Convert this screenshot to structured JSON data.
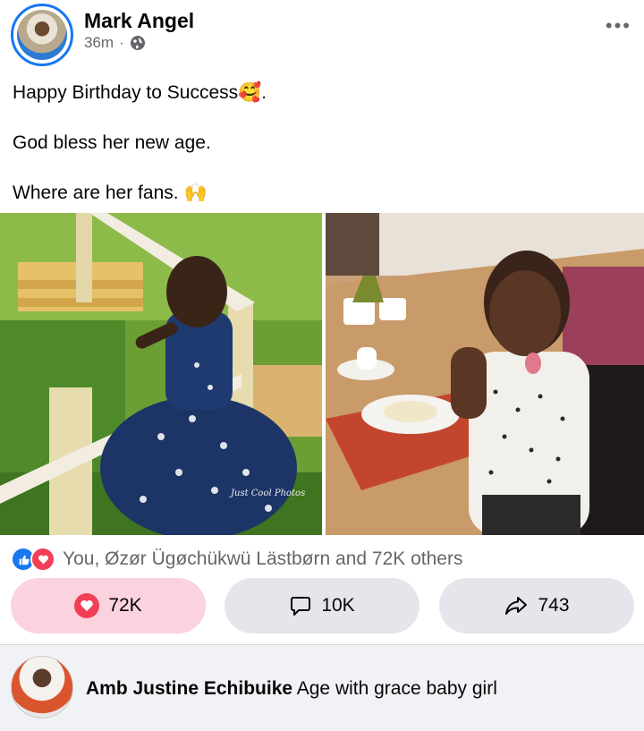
{
  "post": {
    "author": "Mark Angel",
    "time": "36m",
    "separator": "·",
    "more_label": "•••",
    "lines": [
      "Happy Birthday to Success",
      ".",
      "God bless her new age.",
      "Where are her fans."
    ],
    "emoji_1": "🥰",
    "emoji_2": "🙌",
    "photo_watermark": "Just Cool Photos"
  },
  "reactions": {
    "text": "You, Øzør Ügøchükwü Lästbørn and 72K others"
  },
  "actions": {
    "like_count": "72K",
    "comment_count": "10K",
    "share_count": "743"
  },
  "comment": {
    "name": "Amb Justine Echibuike",
    "text": "Age with grace baby girl"
  },
  "colors": {
    "accent": "#1877f2",
    "love": "#f33e58"
  }
}
